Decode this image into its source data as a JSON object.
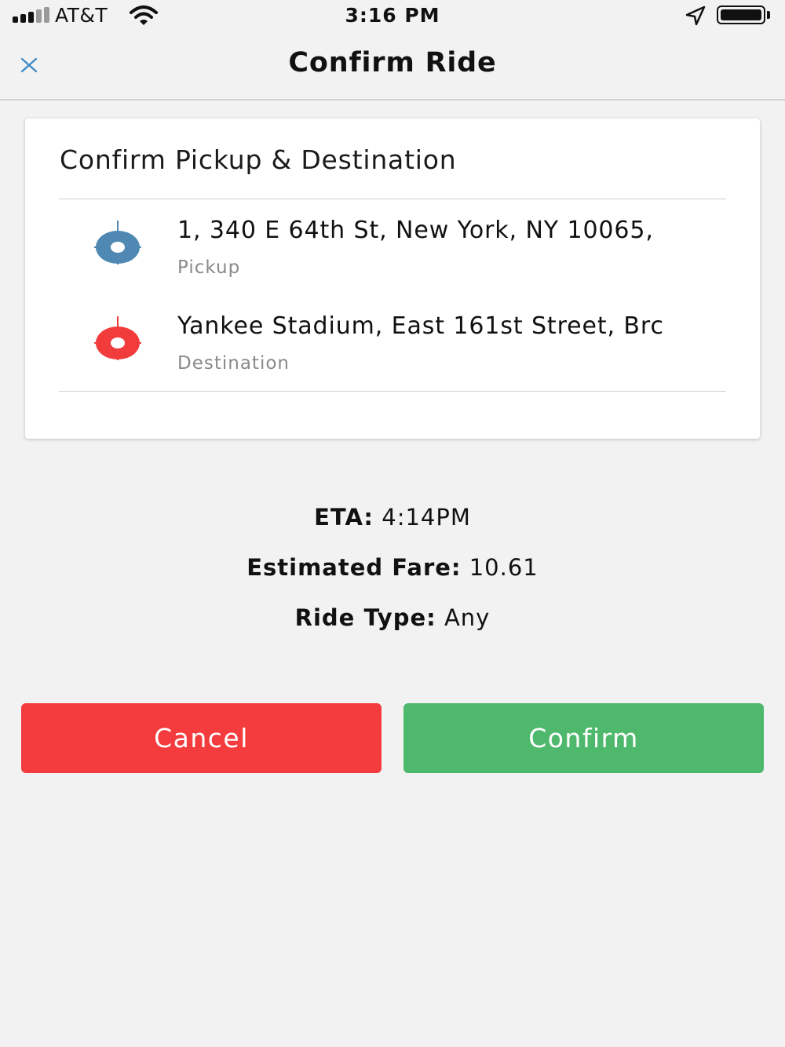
{
  "status_bar": {
    "carrier": "AT&T",
    "time": "3:16 PM",
    "signal_bars_filled": 3,
    "signal_bars_total": 5
  },
  "header": {
    "title": "Confirm Ride",
    "close_icon": "close-icon"
  },
  "card": {
    "title": "Confirm Pickup & Destination",
    "pickup": {
      "address": "1, 340 E 64th St, New York, NY 10065,",
      "label": "Pickup",
      "icon": "crosshair-icon",
      "color": "#4f88b2"
    },
    "destination": {
      "address": "Yankee Stadium, East 161st Street, Brc",
      "label": "Destination",
      "icon": "crosshair-icon",
      "color": "#f23c3c"
    }
  },
  "ride_info": {
    "eta_label": "ETA:",
    "eta_value": "4:14PM",
    "fare_label": "Estimated Fare:",
    "fare_value": "10.61",
    "type_label": "Ride Type:",
    "type_value": "Any"
  },
  "actions": {
    "cancel_label": "Cancel",
    "cancel_color": "#f43b3e",
    "confirm_label": "Confirm",
    "confirm_color": "#4eb86d"
  }
}
